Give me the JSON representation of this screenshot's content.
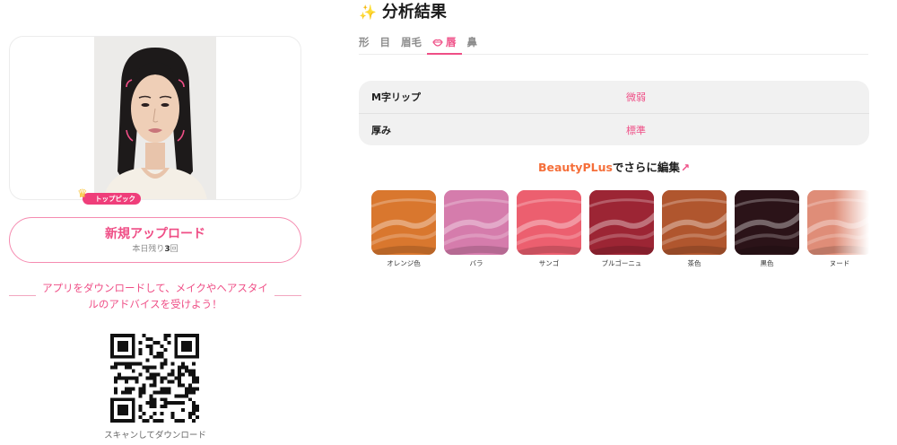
{
  "page": {
    "title": "分析結果",
    "title_icon": "sparkle-icon"
  },
  "tabs": [
    {
      "label": "形",
      "active": false
    },
    {
      "label": "目",
      "active": false
    },
    {
      "label": "眉毛",
      "active": false
    },
    {
      "label": "唇",
      "active": true,
      "icon": "lip-icon"
    },
    {
      "label": "鼻",
      "active": false
    }
  ],
  "metrics": [
    {
      "label": "M字リップ",
      "value": "微弱"
    },
    {
      "label": "厚み",
      "value": "標準"
    }
  ],
  "edit_link": {
    "brand": "BeautyPLus",
    "suffix": "でさらに編集",
    "icon": "arrow-up-right-icon"
  },
  "swatches": [
    {
      "name": "オレンジ色",
      "color": "#d9772e",
      "top_pick": false
    },
    {
      "name": "バラ",
      "color": "#d57cac",
      "top_pick": true
    },
    {
      "name": "サンゴ",
      "color": "#ec5f6f",
      "top_pick": false
    },
    {
      "name": "ブルゴーニュ",
      "color": "#9c2534",
      "top_pick": false
    },
    {
      "name": "茶色",
      "color": "#b0562e",
      "top_pick": false
    },
    {
      "name": "黒色",
      "color": "#2b1318",
      "top_pick": false
    },
    {
      "name": "ヌード",
      "color": "#df8d78",
      "top_pick": false
    }
  ],
  "top_pick_badge": "トップピック",
  "upload": {
    "label": "新規アップロード",
    "remaining_prefix": "本日残り",
    "remaining_count": "3",
    "remaining_suffix": "回"
  },
  "promo_text": "アプリをダウンロードして、メイクやヘアスタイルのアドバイスを受けよう！",
  "qr_caption": "スキャンしてダウンロード",
  "colors": {
    "accent": "#ef4e86",
    "brand_orange": "#f56f3a",
    "panel_bg": "#f1f1f1"
  }
}
